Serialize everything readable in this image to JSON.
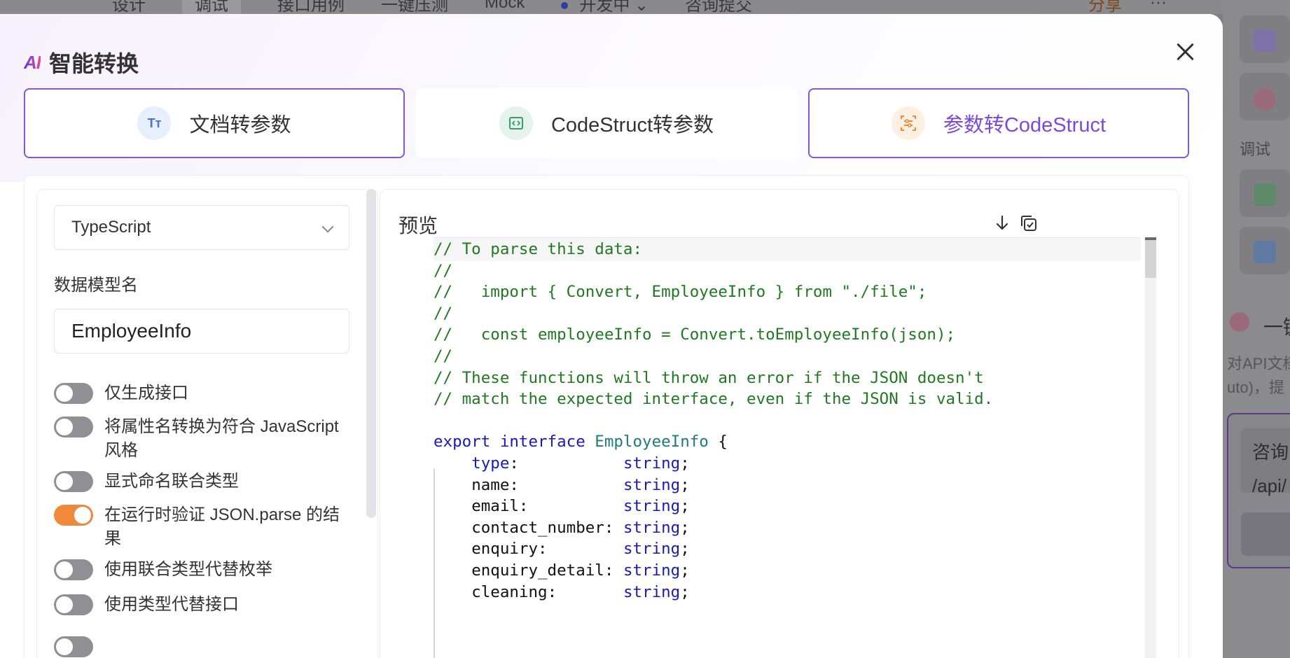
{
  "background": {
    "tabs": [
      "设计",
      "调试",
      "接口用例",
      "一键压测",
      "Mock"
    ],
    "selected_tab": "调试",
    "status": "开发中",
    "title": "咨询提交",
    "share_label": "分享",
    "side_label": "调试",
    "side_section_title": "一键",
    "side_text_1": "对API文档",
    "side_text_2": "uto)，提",
    "card_line_1": "咨询",
    "card_line_2": "/api/"
  },
  "modal": {
    "logo": "AI",
    "title": "智能转换",
    "tabs": [
      {
        "label": "文档转参数",
        "icon": "text-format-icon",
        "state": "outlined"
      },
      {
        "label": "CodeStruct转参数",
        "icon": "code-icon",
        "state": "plain"
      },
      {
        "label": "参数转CodeStruct",
        "icon": "struct-icon",
        "state": "active"
      }
    ],
    "accent_color": "#7a4ae0",
    "toggle_on_color": "#f0893a"
  },
  "options": {
    "language": "TypeScript",
    "model_name_label": "数据模型名",
    "model_name_value": "EmployeeInfo",
    "switches": [
      {
        "label": "仅生成接口",
        "on": false
      },
      {
        "label": "将属性名转换为符合 JavaScript 风格",
        "on": false
      },
      {
        "label": "显式命名联合类型",
        "on": false
      },
      {
        "label": "在运行时验证 JSON.parse 的结果",
        "on": true
      },
      {
        "label": "使用联合类型代替枚举",
        "on": false
      },
      {
        "label": "使用类型代替接口",
        "on": false
      }
    ]
  },
  "preview": {
    "title": "预览",
    "code": {
      "c1": "// To parse this data:",
      "c2": "//",
      "c3": "//   import { Convert, EmployeeInfo } from \"./file\";",
      "c4": "//",
      "c5": "//   const employeeInfo = Convert.toEmployeeInfo(json);",
      "c6": "//",
      "c7": "// These functions will throw an error if the JSON doesn't",
      "c8": "// match the expected interface, even if the JSON is valid.",
      "kw_export": "export",
      "kw_interface": "interface",
      "type_name": "EmployeeInfo",
      "brace": " {",
      "fields": [
        {
          "name": "type",
          "pad": ":           ",
          "type": "string",
          "keyword_name": true
        },
        {
          "name": "name",
          "pad": ":           ",
          "type": "string"
        },
        {
          "name": "email",
          "pad": ":          ",
          "type": "string"
        },
        {
          "name": "contact_number",
          "pad": ": ",
          "type": "string"
        },
        {
          "name": "enquiry",
          "pad": ":        ",
          "type": "string"
        },
        {
          "name": "enquiry_detail",
          "pad": ": ",
          "type": "string"
        },
        {
          "name": "cleaning",
          "pad": ":       ",
          "type": "string"
        }
      ]
    }
  }
}
